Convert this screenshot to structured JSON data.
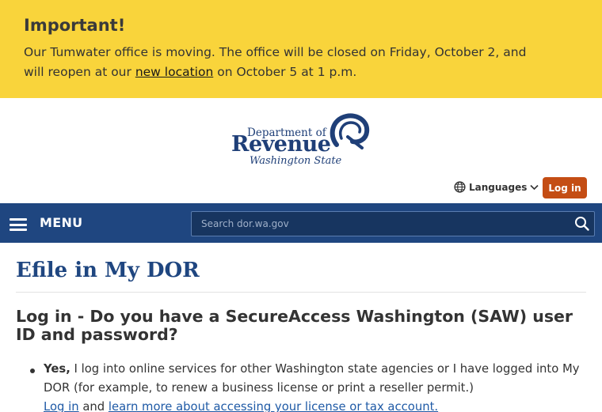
{
  "alert": {
    "title": "Important!",
    "text_before": "Our Tumwater office is moving. The office will be closed on Friday, October 2, and will reopen at our ",
    "link": "new location",
    "text_after": " on October 5 at 1 p.m."
  },
  "logo": {
    "line1": "Department of",
    "line2": "Revenue",
    "line3": "Washington State"
  },
  "header": {
    "languages_label": "Languages",
    "login_label": "Log in"
  },
  "nav": {
    "menu_label": "MENU",
    "search_placeholder": "Search dor.wa.gov"
  },
  "main": {
    "title": "Efile in My DOR",
    "heading": "Log in - Do you have a SecureAccess Washington (SAW) user ID and password?",
    "option": {
      "bold": "Yes,",
      "text": " I log into online services for other Washington state agencies or I have logged into My DOR (for example, to renew a business license or print a reseller permit.)",
      "link1": "Log in",
      "and": " and ",
      "link2": "learn more about accessing your license or tax account."
    }
  },
  "colors": {
    "alert_bg": "#f9d43b",
    "nav_bg": "#1f4680",
    "login_bg": "#c44d14",
    "title": "#1f4680",
    "link": "#1f5aa6"
  }
}
